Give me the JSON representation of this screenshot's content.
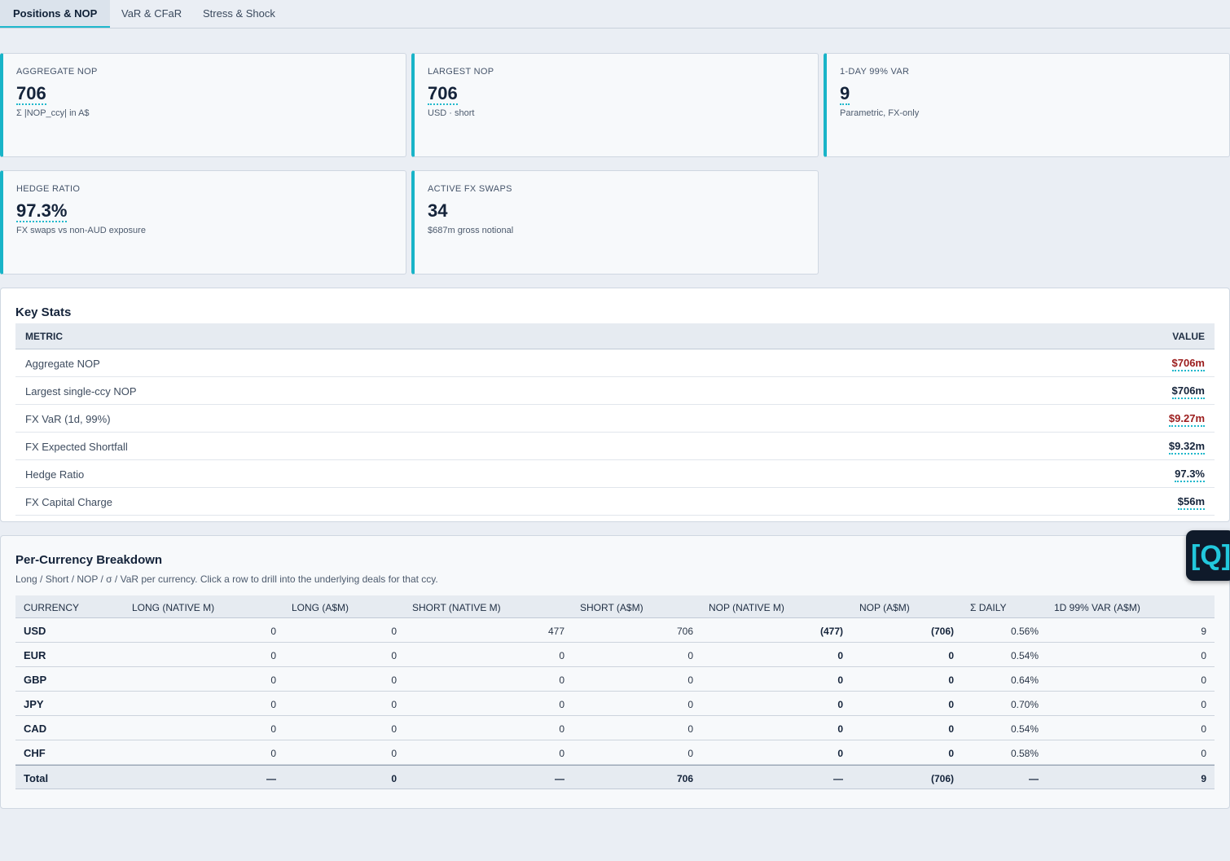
{
  "tabs": [
    {
      "label": "Positions & NOP"
    },
    {
      "label": "VaR & CFaR"
    },
    {
      "label": "Stress & Shock"
    }
  ],
  "kpis": [
    {
      "label": "AGGREGATE NOP",
      "value": "706",
      "sub": "Σ |NOP_ccy| in A$"
    },
    {
      "label": "LARGEST NOP",
      "value": "706",
      "sub": "USD · short"
    },
    {
      "label": "1-DAY 99% VAR",
      "value": "9",
      "sub": "Parametric, FX-only"
    },
    {
      "label": "HEDGE RATIO",
      "value": "97.3%",
      "sub": "FX swaps vs non-AUD exposure"
    },
    {
      "label": "ACTIVE FX SWAPS",
      "value": "34",
      "sub": "$687m gross notional"
    }
  ],
  "key_stats": {
    "title": "Key Stats",
    "headers": {
      "metric": "METRIC",
      "value": "VALUE"
    },
    "rows": [
      {
        "metric": "Aggregate NOP",
        "value": "$706m"
      },
      {
        "metric": "Largest single-ccy NOP",
        "value": "$706m"
      },
      {
        "metric": "FX VaR (1d, 99%)",
        "value": "$9.27m"
      },
      {
        "metric": "FX Expected Shortfall",
        "value": "$9.32m"
      },
      {
        "metric": "Hedge Ratio",
        "value": "97.3%"
      },
      {
        "metric": "FX Capital Charge",
        "value": "$56m"
      }
    ]
  },
  "breakdown": {
    "title": "Per-Currency Breakdown",
    "description": "Long / Short / NOP / σ / VaR per currency. Click a row to drill into the underlying deals for that ccy.",
    "headers": [
      "CURRENCY",
      "LONG (NATIVE M)",
      "LONG (A$M)",
      "SHORT (NATIVE M)",
      "SHORT (A$M)",
      "NOP (NATIVE M)",
      "NOP (A$M)",
      "Σ DAILY",
      "1D 99% VAR (A$M)"
    ],
    "rows": [
      [
        "USD",
        "0",
        "0",
        "477",
        "706",
        "(477)",
        "(706)",
        "0.56%",
        "9"
      ],
      [
        "EUR",
        "0",
        "0",
        "0",
        "0",
        "0",
        "0",
        "0.54%",
        "0"
      ],
      [
        "GBP",
        "0",
        "0",
        "0",
        "0",
        "0",
        "0",
        "0.64%",
        "0"
      ],
      [
        "JPY",
        "0",
        "0",
        "0",
        "0",
        "0",
        "0",
        "0.70%",
        "0"
      ],
      [
        "CAD",
        "0",
        "0",
        "0",
        "0",
        "0",
        "0",
        "0.54%",
        "0"
      ],
      [
        "CHF",
        "0",
        "0",
        "0",
        "0",
        "0",
        "0",
        "0.58%",
        "0"
      ]
    ],
    "total": [
      "Total",
      "—",
      "0",
      "—",
      "706",
      "—",
      "(706)",
      "—",
      "9"
    ]
  },
  "badge": {
    "label": "[Q]"
  }
}
